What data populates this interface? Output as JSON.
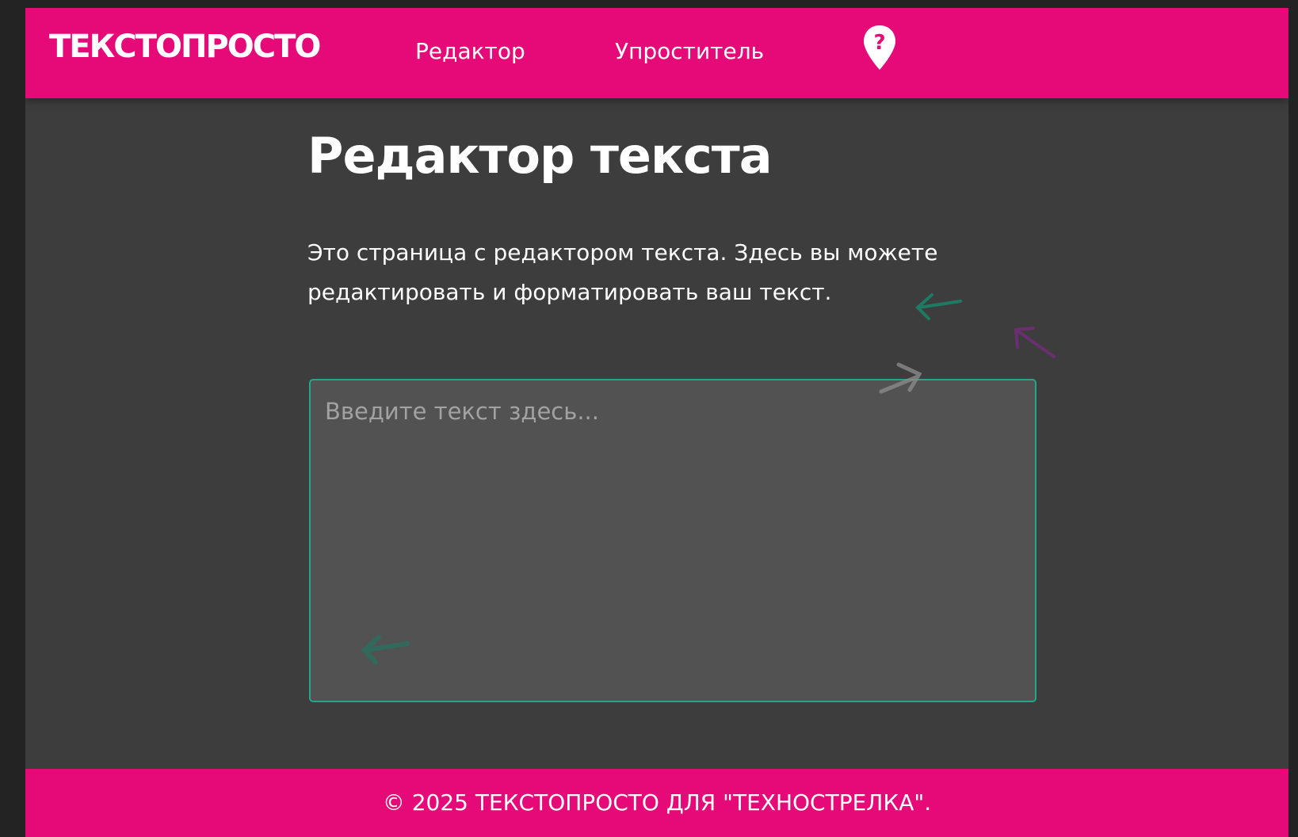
{
  "header": {
    "logo": "ТЕКСТОПРОСТО",
    "nav": [
      {
        "label": "Редактор"
      },
      {
        "label": "Упроститель"
      }
    ],
    "help_icon": "help-map-pin-icon"
  },
  "main": {
    "title": "Редактор текста",
    "intro": "Это страница с редактором текста. Здесь вы можете редактировать и форматировать ваш текст.",
    "editor": {
      "value": "",
      "placeholder": "Введите текст здесь..."
    }
  },
  "footer": {
    "text": "© 2025 ТЕКСТОПРОСТО ДЛЯ \"ТЕХНОСТРЕЛКА\"."
  },
  "colors": {
    "brand": "#e50a78",
    "background": "#3d3d3d",
    "editor_background": "#525252",
    "editor_border": "#1fa889",
    "text": "#ffffff"
  }
}
